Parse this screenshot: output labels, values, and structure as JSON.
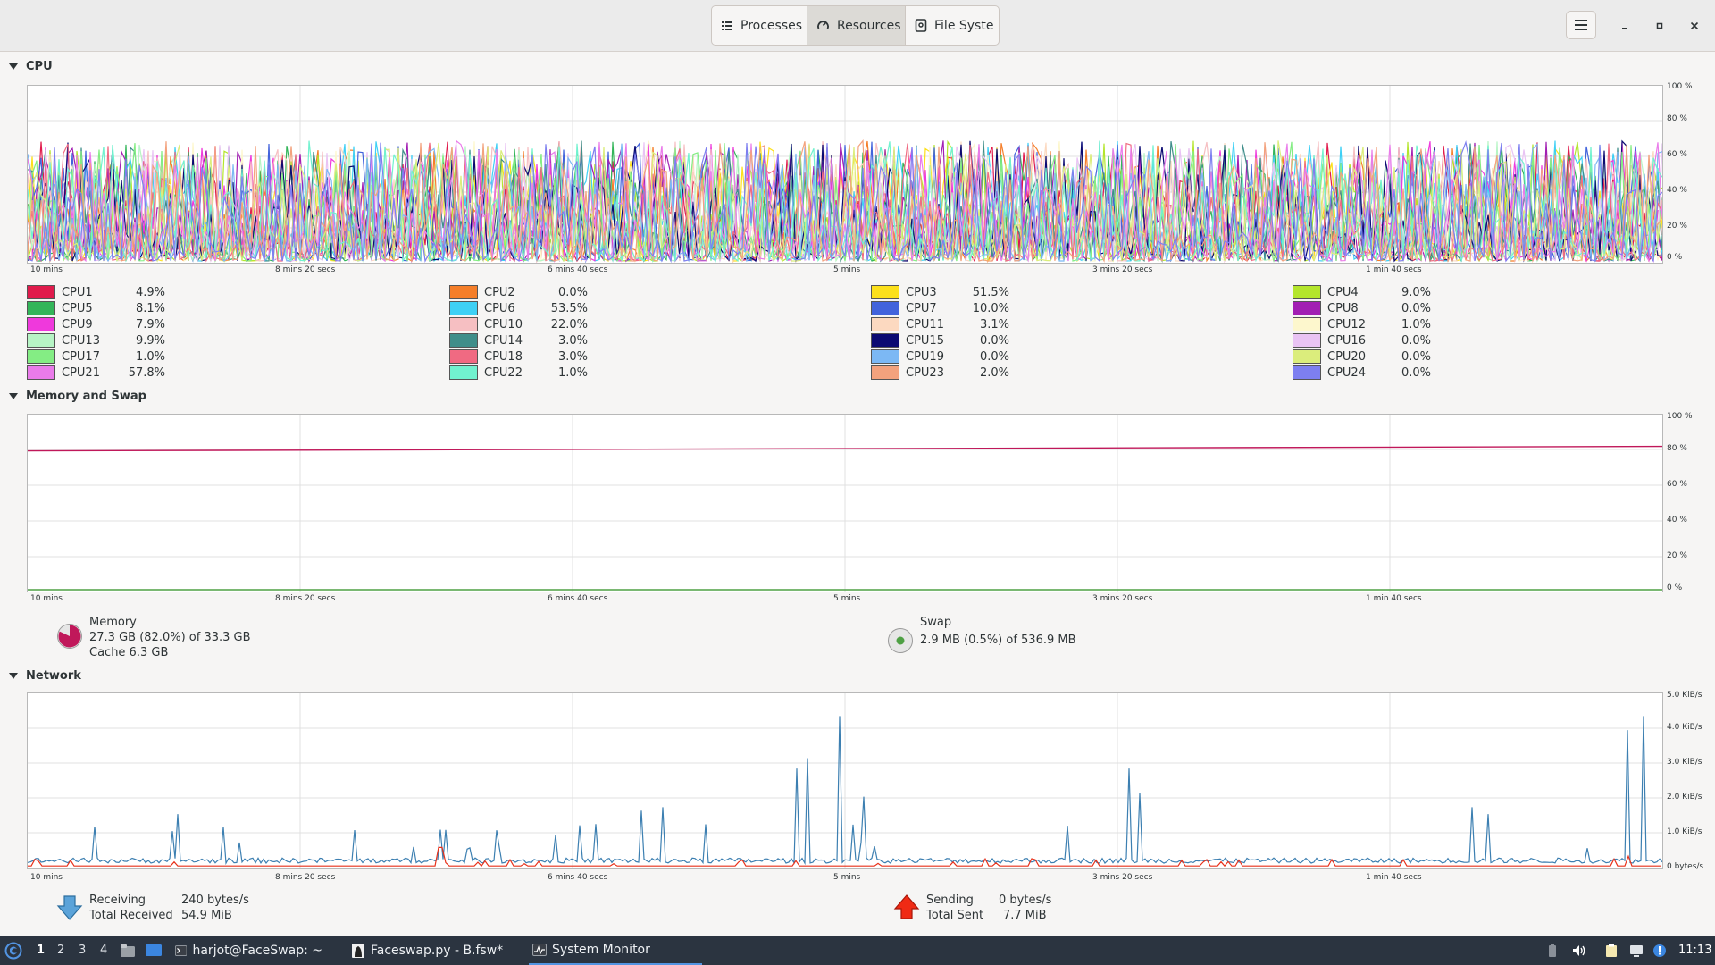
{
  "header": {
    "tabs": [
      {
        "label": "Processes",
        "icon": "list-icon"
      },
      {
        "label": "Resources",
        "icon": "gauge-icon"
      },
      {
        "label": "File Syste",
        "icon": "disk-icon"
      }
    ],
    "active_tab": "Resources"
  },
  "x_axis_labels": [
    "10 mins",
    "8 mins 20 secs",
    "6 mins 40 secs",
    "5 mins",
    "3 mins 20 secs",
    "1 min 40 secs"
  ],
  "cpu": {
    "title": "CPU",
    "y_axis_labels": [
      "100 %",
      "80 %",
      "60 %",
      "40 %",
      "20 %",
      "0 %"
    ],
    "cores": [
      {
        "name": "CPU1",
        "value": "4.9%",
        "color": "#e01b4c"
      },
      {
        "name": "CPU2",
        "value": "0.0%",
        "color": "#f57e29"
      },
      {
        "name": "CPU3",
        "value": "51.5%",
        "color": "#fce01b"
      },
      {
        "name": "CPU4",
        "value": "9.0%",
        "color": "#b4e52c"
      },
      {
        "name": "CPU5",
        "value": "8.1%",
        "color": "#33b559"
      },
      {
        "name": "CPU6",
        "value": "53.5%",
        "color": "#3ed0f5"
      },
      {
        "name": "CPU7",
        "value": "10.0%",
        "color": "#4263dc"
      },
      {
        "name": "CPU8",
        "value": "0.0%",
        "color": "#a21fb3"
      },
      {
        "name": "CPU9",
        "value": "7.9%",
        "color": "#ef39dc"
      },
      {
        "name": "CPU10",
        "value": "22.0%",
        "color": "#f6bfc2"
      },
      {
        "name": "CPU11",
        "value": "3.1%",
        "color": "#fcd9c0"
      },
      {
        "name": "CPU12",
        "value": "1.0%",
        "color": "#fdf7cd"
      },
      {
        "name": "CPU13",
        "value": "9.9%",
        "color": "#b7f5c5"
      },
      {
        "name": "CPU14",
        "value": "3.0%",
        "color": "#3f8e8a"
      },
      {
        "name": "CPU15",
        "value": "0.0%",
        "color": "#0b0a72"
      },
      {
        "name": "CPU16",
        "value": "0.0%",
        "color": "#e9c3f4"
      },
      {
        "name": "CPU17",
        "value": "1.0%",
        "color": "#84ed84"
      },
      {
        "name": "CPU18",
        "value": "3.0%",
        "color": "#f06a82"
      },
      {
        "name": "CPU19",
        "value": "0.0%",
        "color": "#7cb8f4"
      },
      {
        "name": "CPU20",
        "value": "0.0%",
        "color": "#dbed7c"
      },
      {
        "name": "CPU21",
        "value": "57.8%",
        "color": "#ea7bea"
      },
      {
        "name": "CPU22",
        "value": "1.0%",
        "color": "#71f2cf"
      },
      {
        "name": "CPU23",
        "value": "2.0%",
        "color": "#f3a27d"
      },
      {
        "name": "CPU24",
        "value": "0.0%",
        "color": "#7d7ff0"
      }
    ]
  },
  "memory": {
    "title": "Memory and Swap",
    "y_axis_labels": [
      "100 %",
      "80 %",
      "60 %",
      "40 %",
      "20 %",
      "0 %"
    ],
    "memory_label": "Memory",
    "memory_usage": "27.3 GB (82.0%) of 33.3 GB",
    "memory_cache": "Cache 6.3 GB",
    "memory_fraction": 0.82,
    "memory_color": "#c0185a",
    "swap_label": "Swap",
    "swap_usage": "2.9 MB (0.5%) of 536.9 MB",
    "swap_fraction": 0.005,
    "swap_color": "#4ea044"
  },
  "network": {
    "title": "Network",
    "y_axis_labels": [
      "5.0 KiB/s",
      "4.0 KiB/s",
      "3.0 KiB/s",
      "2.0 KiB/s",
      "1.0 KiB/s",
      "0 bytes/s"
    ],
    "receiving_label": "Receiving",
    "receiving_value": "240 bytes/s",
    "total_received_label": "Total Received",
    "total_received_value": "54.9 MiB",
    "sending_label": "Sending",
    "sending_value": "0 bytes/s",
    "total_sent_label": "Total Sent",
    "total_sent_value": "7.7 MiB",
    "receive_color": "#3c7fb1",
    "send_color": "#e8311a"
  },
  "taskbar": {
    "workspaces": [
      "1",
      "2",
      "3",
      "4"
    ],
    "tasks": [
      {
        "label": "harjot@FaceSwap: ~",
        "icon": "terminal-icon"
      },
      {
        "label": "Faceswap.py - B.fsw*",
        "icon": "faceswap-icon"
      },
      {
        "label": "System Monitor",
        "icon": "system-monitor-icon"
      }
    ],
    "clock": "11:13"
  }
}
